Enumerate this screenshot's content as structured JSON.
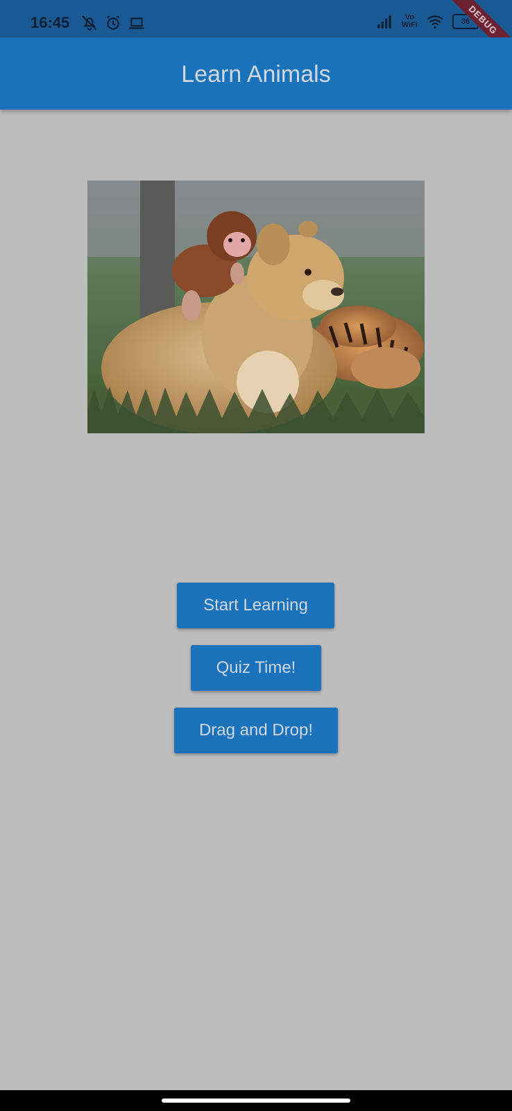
{
  "status_bar": {
    "time": "16:45",
    "icons_left": [
      "bell-off-icon",
      "alarm-clock-icon",
      "laptop-icon"
    ],
    "icons_right": [
      "signal-icon",
      "volte-wifi-icon",
      "wifi-icon",
      "battery-icon"
    ],
    "volte_line1": "Vo",
    "volte_line2": "WiFi",
    "battery_level": "36"
  },
  "debug_banner": "DEBUG",
  "app_bar": {
    "title": "Learn Animals"
  },
  "hero_image": {
    "alt": "Baby monkey riding a lion cub next to tiger cubs"
  },
  "buttons": {
    "start_learning": "Start Learning",
    "quiz_time": "Quiz Time!",
    "drag_and_drop": "Drag and Drop!"
  },
  "colors": {
    "app_bar": "#1a72bb",
    "button": "#1a72bb",
    "background": "#bdbdbd",
    "status_bar": "#1a5a94",
    "debug_ribbon": "#6b2233"
  }
}
